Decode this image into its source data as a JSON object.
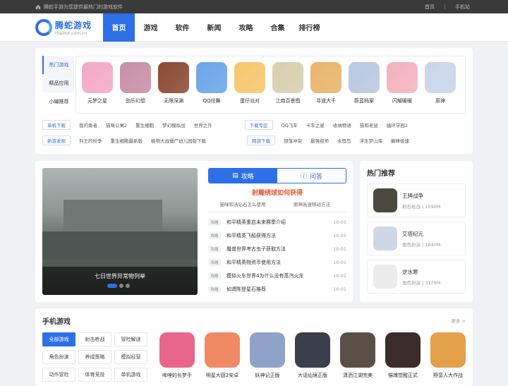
{
  "topbar": {
    "welcome": "腾蛇手游为您提供最热门的游戏软件",
    "links": [
      "首页",
      "手机站"
    ]
  },
  "logo": {
    "name": "腾蛇游戏",
    "url": "thaihot.com.cn"
  },
  "nav": [
    "首页",
    "游戏",
    "软件",
    "新闻",
    "攻略",
    "合集",
    "排行榜"
  ],
  "hot": {
    "tabs": [
      "热门游戏",
      "精品应用",
      "小编推荐"
    ],
    "games": [
      {
        "name": "元梦之星",
        "color": "#f4a9c5"
      },
      {
        "name": "劲乐幻想",
        "color": "#c98fa8"
      },
      {
        "name": "无限深渊",
        "color": "#8a4b35"
      },
      {
        "name": "QQ炫舞",
        "color": "#6aa6e8"
      },
      {
        "name": "蛋仔派对",
        "color": "#f6c66d"
      },
      {
        "name": "江南百景图",
        "color": "#d8cfae"
      },
      {
        "name": "寻道大千",
        "color": "#e8b46a"
      },
      {
        "name": "蔚蓝档案",
        "color": "#b9c8e0"
      },
      {
        "name": "闪耀暖暖",
        "color": "#f2b3c0"
      },
      {
        "name": "原神",
        "color": "#c9d6ea"
      }
    ]
  },
  "links": {
    "row1_left": {
      "tag": "单机下载",
      "items": [
        "我的勇者",
        "猫咪公寓2",
        "重生细胞",
        "梦幻模拟战",
        "世界之外"
      ]
    },
    "row1_right": {
      "tag": "下载专区",
      "items": [
        "QQ飞车",
        "卡车之星",
        "收纳物语",
        "猫和老鼠",
        "幽环学园2"
      ]
    },
    "row2_left": {
      "tag": "新游发现",
      "items": [
        "列王的纷争",
        "重生细胞最新版",
        "植物大战僵尸幼儿园版下载"
      ]
    },
    "row2_right": {
      "tag": "网游下载",
      "items": [
        "部落冲突",
        "最强祖师",
        "永恒岛",
        "浮生梦山海",
        "巅峰极速"
      ]
    }
  },
  "banner": {
    "caption": "七日世界异常物列举"
  },
  "news": {
    "tabs": [
      "攻略",
      "问答"
    ],
    "headline": "射雕绣球如何获得",
    "subs": [
      "猫咪和汤钻石怎么使用",
      "原神高速移动方法"
    ],
    "items": [
      {
        "kind": "攻略",
        "title": "和平精英重启未来赛季介绍",
        "date": "10-01"
      },
      {
        "kind": "攻略",
        "title": "和平精英飞船获得方法",
        "date": "10-01"
      },
      {
        "kind": "攻略",
        "title": "魔兽世界考古虫子获取方法",
        "date": "10-01"
      },
      {
        "kind": "攻略",
        "title": "和平精英物资币使用方法",
        "date": "10-01"
      },
      {
        "kind": "攻略",
        "title": "模拟火车世界4为什么没有蒸汽火车",
        "date": "10-01"
      },
      {
        "kind": "攻略",
        "title": "如鸢陈登星石推荐",
        "date": "10-01"
      }
    ]
  },
  "recommend": {
    "title": "热门推荐",
    "items": [
      {
        "name": "王牌战争",
        "meta": "射击枪战 | 1590M",
        "color": "#4b4a3c"
      },
      {
        "name": "艾塔纪元",
        "meta": "角色扮演 | 1840M",
        "color": "#cfd6e6"
      },
      {
        "name": "逆水寒",
        "meta": "角色扮演 | 3178M",
        "color": "#ececec"
      }
    ]
  },
  "mobile": {
    "title": "手机游戏",
    "more": "更多 >",
    "cats": [
      "全部游戏",
      "射击枪战",
      "冒险解谜",
      "角色扮演",
      "养成策略",
      "模拟经营",
      "动作冒险",
      "体育竞技",
      "单机游戏"
    ],
    "games": [
      {
        "name": "哞哩的长梦手",
        "color": "#e9668b"
      },
      {
        "name": "明星大厨2安卓",
        "color": "#f08a64"
      },
      {
        "name": "妖神记正版",
        "color": "#8fa3c8"
      },
      {
        "name": "大话仙境正版",
        "color": "#3b3f4c"
      },
      {
        "name": "潇洒江湖完美",
        "color": "#5a4f45"
      },
      {
        "name": "猫魂觉醒正式",
        "color": "#3b2b2b"
      },
      {
        "name": "野蛮人大作战",
        "color": "#e3a04b"
      }
    ]
  }
}
